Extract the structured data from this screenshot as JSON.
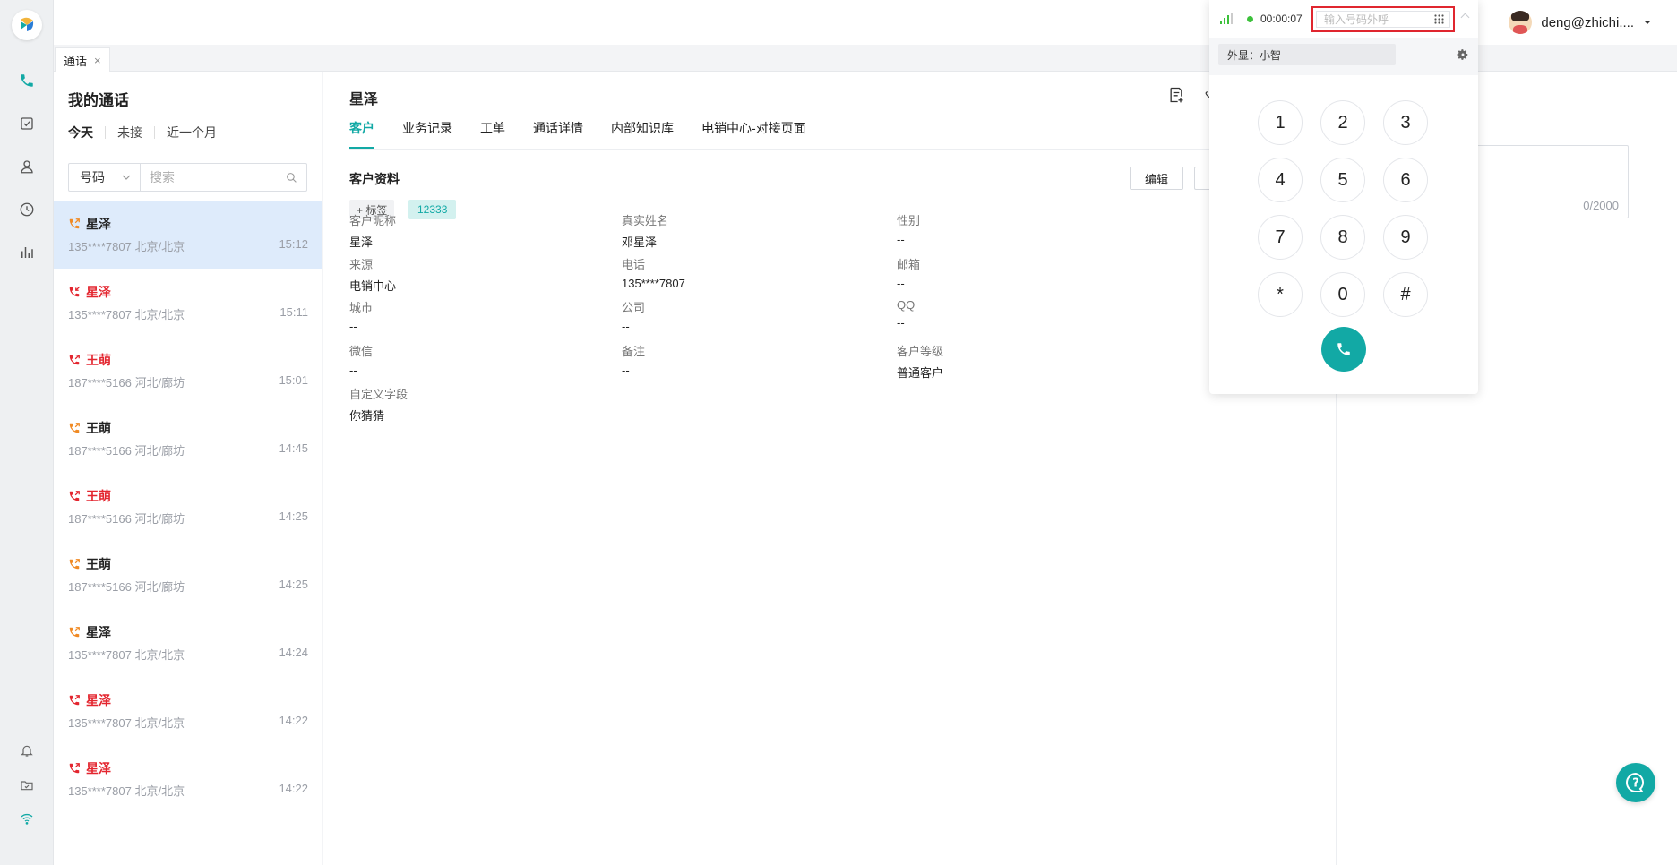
{
  "user": {
    "name": "deng@zhichi...."
  },
  "page_tab": {
    "label": "通话",
    "close": "×"
  },
  "call_list": {
    "title": "我的通话",
    "filters": [
      "今天",
      "未接",
      "近一个月"
    ],
    "search_type": "号码",
    "search_placeholder": "搜索",
    "items": [
      {
        "name": "星泽",
        "sub": "135****7807 北京/北京",
        "time": "15:12",
        "type": "outgoing",
        "color": "#f08a24"
      },
      {
        "name": "星泽",
        "sub": "135****7807 北京/北京",
        "time": "15:11",
        "type": "missed",
        "color": "#e3262f"
      },
      {
        "name": "王萌",
        "sub": "187****5166 河北/廊坊",
        "time": "15:01",
        "type": "outgoing-fail",
        "color": "#e3262f"
      },
      {
        "name": "王萌",
        "sub": "187****5166 河北/廊坊",
        "time": "14:45",
        "type": "outgoing",
        "color": "#f08a24"
      },
      {
        "name": "王萌",
        "sub": "187****5166 河北/廊坊",
        "time": "14:25",
        "type": "outgoing-fail",
        "color": "#e3262f"
      },
      {
        "name": "王萌",
        "sub": "187****5166 河北/廊坊",
        "time": "14:25",
        "type": "outgoing",
        "color": "#f08a24"
      },
      {
        "name": "星泽",
        "sub": "135****7807 北京/北京",
        "time": "14:24",
        "type": "outgoing",
        "color": "#f08a24"
      },
      {
        "name": "星泽",
        "sub": "135****7807 北京/北京",
        "time": "14:22",
        "type": "outgoing-fail",
        "color": "#e3262f"
      },
      {
        "name": "星泽",
        "sub": "135****7807 北京/北京",
        "time": "14:22",
        "type": "outgoing-fail",
        "color": "#e3262f"
      }
    ]
  },
  "customer": {
    "title": "星泽",
    "tabs": [
      "客户",
      "业务记录",
      "工单",
      "通话详情",
      "内部知识库",
      "电销中心-对接页面"
    ],
    "section_title": "客户资料",
    "edit_label": "编辑",
    "add_tag_label": "+ 标签",
    "tag": "12333",
    "fields": [
      {
        "label": "客户昵称",
        "value": "星泽"
      },
      {
        "label": "真实姓名",
        "value": "邓星泽"
      },
      {
        "label": "性别",
        "value": "--"
      },
      {
        "label": "来源",
        "value": "电销中心"
      },
      {
        "label": "电话",
        "value": "135****7807"
      },
      {
        "label": "邮箱",
        "value": "--"
      },
      {
        "label": "城市",
        "value": "--"
      },
      {
        "label": "公司",
        "value": "--"
      },
      {
        "label": "QQ",
        "value": "--"
      },
      {
        "label": "微信",
        "value": "--"
      },
      {
        "label": "备注",
        "value": "--"
      },
      {
        "label": "客户等级",
        "value": "普通客户"
      },
      {
        "label": "自定义字段",
        "value": "你猜猜"
      }
    ]
  },
  "notes": {
    "counter": "0/2000"
  },
  "dialer": {
    "timer": "00:00:07",
    "input_placeholder": "输入号码外呼",
    "caller_id": "外显：小智",
    "keys": [
      "1",
      "2",
      "3",
      "4",
      "5",
      "6",
      "7",
      "8",
      "9",
      "*",
      "0",
      "#"
    ]
  },
  "colors": {
    "accent": "#12a9a5",
    "missed": "#e3262f",
    "outgoing": "#f08a24",
    "highlight_box": "#e0262f"
  }
}
